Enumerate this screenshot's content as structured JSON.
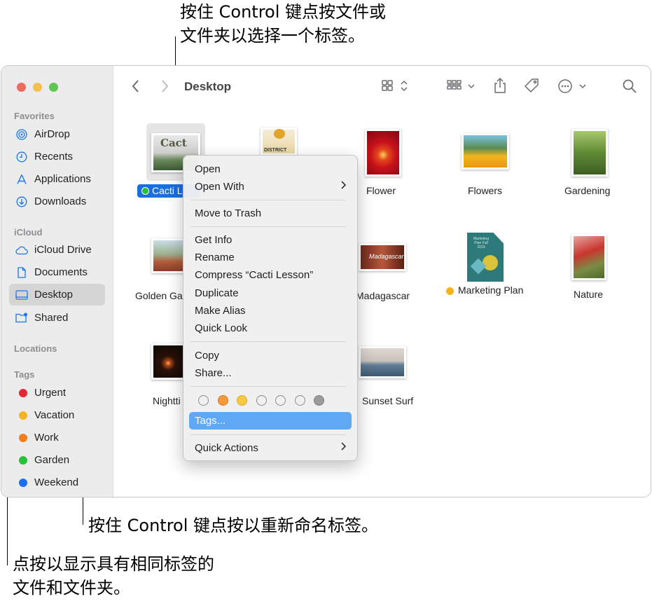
{
  "callouts": {
    "top_line1": "按住 Control 键点按文件或",
    "top_line2": "文件夹以选择一个标签。",
    "middle": "按住 Control 键点按以重新命名标签。",
    "bottom_line1": "点按以显示具有相同标签的",
    "bottom_line2": "文件和文件夹。"
  },
  "window": {
    "title": "Desktop",
    "toolbar_icons": [
      "back-chevron-icon",
      "forward-chevron-icon",
      "grid-view-icon",
      "group-icon",
      "share-icon",
      "tag-icon",
      "more-icon",
      "search-icon"
    ]
  },
  "sidebar": {
    "favorites_header": "Favorites",
    "favorites": [
      {
        "label": "AirDrop",
        "icon": "airdrop-icon"
      },
      {
        "label": "Recents",
        "icon": "clock-icon"
      },
      {
        "label": "Applications",
        "icon": "applications-icon"
      },
      {
        "label": "Downloads",
        "icon": "download-icon"
      }
    ],
    "icloud_header": "iCloud",
    "icloud": [
      {
        "label": "iCloud Drive",
        "icon": "cloud-icon"
      },
      {
        "label": "Documents",
        "icon": "document-icon"
      },
      {
        "label": "Desktop",
        "icon": "desktop-icon",
        "selected": true
      },
      {
        "label": "Shared",
        "icon": "shared-folder-icon"
      }
    ],
    "locations_header": "Locations",
    "tags_header": "Tags",
    "tags": [
      {
        "label": "Urgent",
        "color": "#e8262d"
      },
      {
        "label": "Vacation",
        "color": "#f5b41e"
      },
      {
        "label": "Work",
        "color": "#f27d1f"
      },
      {
        "label": "Garden",
        "color": "#27c23a"
      },
      {
        "label": "Weekend",
        "color": "#1c6ff0"
      }
    ]
  },
  "files": [
    {
      "label": "Cacti L",
      "selected": true,
      "tag_color": "#27c23a",
      "thumb_text": "Cact"
    },
    {
      "label": "",
      "thumb_text": "DISTRICT"
    },
    {
      "label": "Flower"
    },
    {
      "label": "Flowers"
    },
    {
      "label": "Gardening"
    },
    {
      "label": "Golden Ga"
    },
    {
      "label": "",
      "thumb_text": ""
    },
    {
      "label": "Madagascar",
      "thumb_text": "Madagascar"
    },
    {
      "label": "Marketing Plan",
      "tag_color": "#f5b41e",
      "thumb_text": "Marketing Plan Fall 2019"
    },
    {
      "label": "Nature"
    },
    {
      "label": "Nightti"
    },
    {
      "label": "Sunset Surf"
    }
  ],
  "context_menu": {
    "items": [
      {
        "label": "Open"
      },
      {
        "label": "Open With",
        "submenu": true
      },
      {
        "label": "Move to Trash"
      },
      {
        "label": "Get Info"
      },
      {
        "label": "Rename"
      },
      {
        "label": "Compress “Cacti Lesson”"
      },
      {
        "label": "Duplicate"
      },
      {
        "label": "Make Alias"
      },
      {
        "label": "Quick Look"
      },
      {
        "label": "Copy"
      },
      {
        "label": "Share..."
      },
      {
        "label": "Tags...",
        "highlighted": true
      },
      {
        "label": "Quick Actions",
        "submenu": true
      }
    ],
    "tag_colors": [
      "none",
      "#f5993a",
      "#f7c945",
      "none",
      "none",
      "none",
      "#9b9b9b"
    ]
  }
}
